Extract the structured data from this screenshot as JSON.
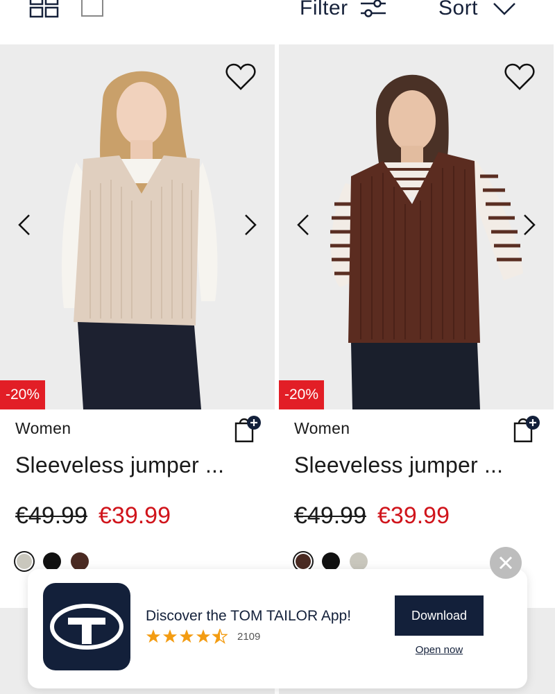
{
  "toolbar": {
    "filter_label": "Filter",
    "sort_label": "Sort"
  },
  "products": [
    {
      "discount_badge": "-20%",
      "category": "Women",
      "title": "Sleeveless jumper ...",
      "old_price": "€49.99",
      "new_price": "€39.99",
      "swatches": [
        "#c9c7bd",
        "#111111",
        "#4a2a22"
      ],
      "selected_swatch": 0
    },
    {
      "discount_badge": "-20%",
      "category": "Women",
      "title": "Sleeveless jumper ...",
      "old_price": "€49.99",
      "new_price": "€39.99",
      "swatches": [
        "#4a2a22",
        "#111111",
        "#c9c7bd"
      ],
      "selected_swatch": 0
    }
  ],
  "app_banner": {
    "title": "Discover the TOM TAILOR App!",
    "rating": 4.5,
    "rating_count": "2109",
    "download_label": "Download",
    "open_label": "Open now"
  },
  "colors": {
    "brand_navy": "#13203a",
    "sale_red": "#d0141b",
    "badge_red": "#e21e26",
    "star_orange": "#f39c12"
  },
  "icons": [
    "grid-view-icon",
    "single-view-icon",
    "filter-sliders-icon",
    "chevron-down-icon",
    "heart-icon",
    "chevron-left-icon",
    "chevron-right-icon",
    "add-to-bag-icon",
    "close-icon",
    "star-icon",
    "tom-tailor-logo-icon"
  ]
}
